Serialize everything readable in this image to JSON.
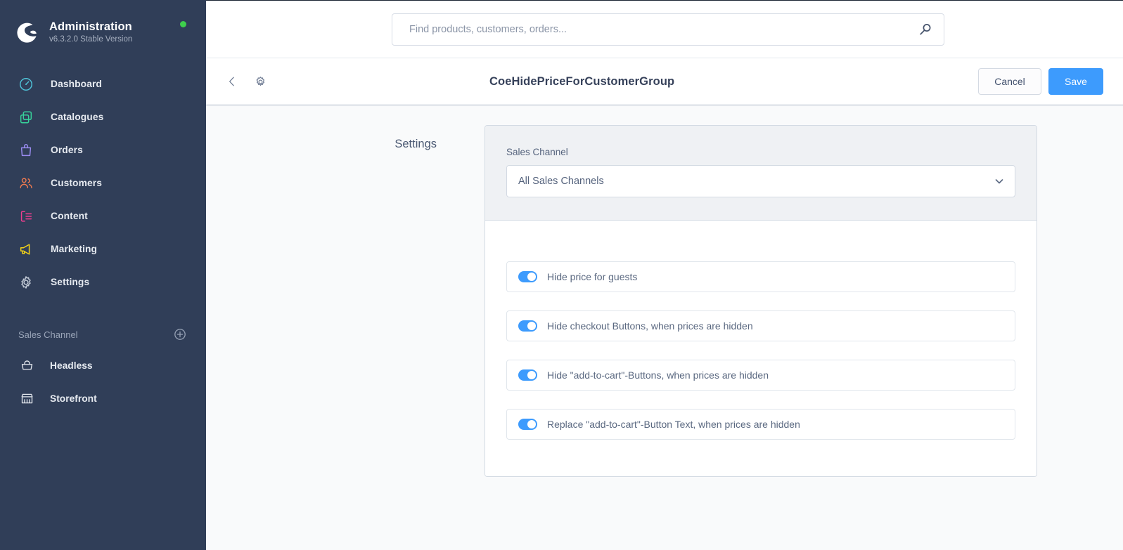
{
  "sidebar": {
    "brand": {
      "logo_icon": "shopware-logo-icon",
      "title": "Administration",
      "version": "v6.3.2.0 Stable Version",
      "status_dot_color": "#3ecf4c"
    },
    "nav_items": [
      {
        "label": "Dashboard",
        "icon": "dashboard-gauge-icon",
        "color": "#4fc3d8"
      },
      {
        "label": "Catalogues",
        "icon": "catalogues-copy-icon",
        "color": "#37d39b"
      },
      {
        "label": "Orders",
        "icon": "orders-bag-icon",
        "color": "#9a8cf0"
      },
      {
        "label": "Customers",
        "icon": "customers-people-icon",
        "color": "#f07a4f"
      },
      {
        "label": "Content",
        "icon": "content-list-icon",
        "color": "#ee3e8f"
      },
      {
        "label": "Marketing",
        "icon": "marketing-megaphone-icon",
        "color": "#f5d417"
      },
      {
        "label": "Settings",
        "icon": "settings-gear-icon",
        "color": "#c4ccd8"
      }
    ],
    "sales_channel_section": {
      "title": "Sales Channel",
      "add_icon": "plus-circle-icon",
      "channels": [
        {
          "label": "Headless",
          "icon": "basket-icon"
        },
        {
          "label": "Storefront",
          "icon": "storefront-icon"
        }
      ]
    }
  },
  "topbar": {
    "search": {
      "placeholder": "Find products, customers, orders...",
      "value": "",
      "icon": "search-icon"
    }
  },
  "toolbar": {
    "back_icon": "chevron-left-icon",
    "settings_icon": "gear-icon",
    "title": "CoeHidePriceForCustomerGroup",
    "cancel_label": "Cancel",
    "save_label": "Save",
    "save_color": "#3d9bfd"
  },
  "content": {
    "section_label": "Settings",
    "sales_channel": {
      "field_label": "Sales Channel",
      "selected_value": "All Sales Channels",
      "chevron_icon": "chevron-down-icon"
    },
    "toggles": [
      {
        "label": "Hide price for guests",
        "on": true
      },
      {
        "label": "Hide checkout Buttons, when prices are hidden",
        "on": true
      },
      {
        "label": "Hide \"add-to-cart\"-Buttons, when prices are hidden",
        "on": true
      },
      {
        "label": "Replace \"add-to-cart\"-Button Text, when prices are hidden",
        "on": true
      }
    ]
  }
}
